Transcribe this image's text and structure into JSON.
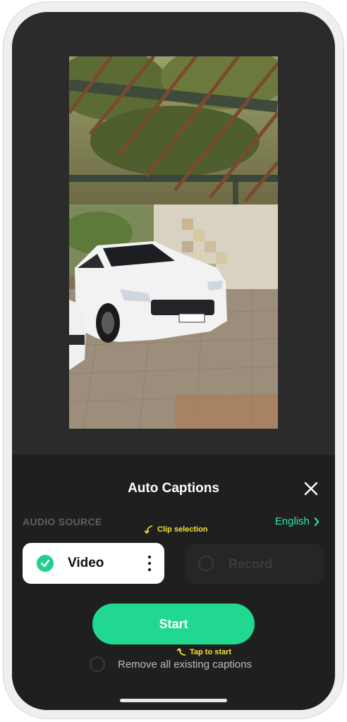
{
  "panel": {
    "title": "Auto Captions",
    "close_icon": "close-icon"
  },
  "audio_source": {
    "label": "AUDIO SOURCE",
    "language": "English",
    "options": [
      {
        "label": "Video",
        "selected": true
      },
      {
        "label": "Record",
        "selected": false
      }
    ]
  },
  "annotations": {
    "clip": "Clip selection",
    "tap": "Tap to start"
  },
  "start_button": "Start",
  "remove_option": {
    "label": "Remove all existing captions",
    "checked": false
  },
  "colors": {
    "accent": "#20d88f",
    "annotation": "#f2e338",
    "panel_bg": "#1f1f1f"
  }
}
